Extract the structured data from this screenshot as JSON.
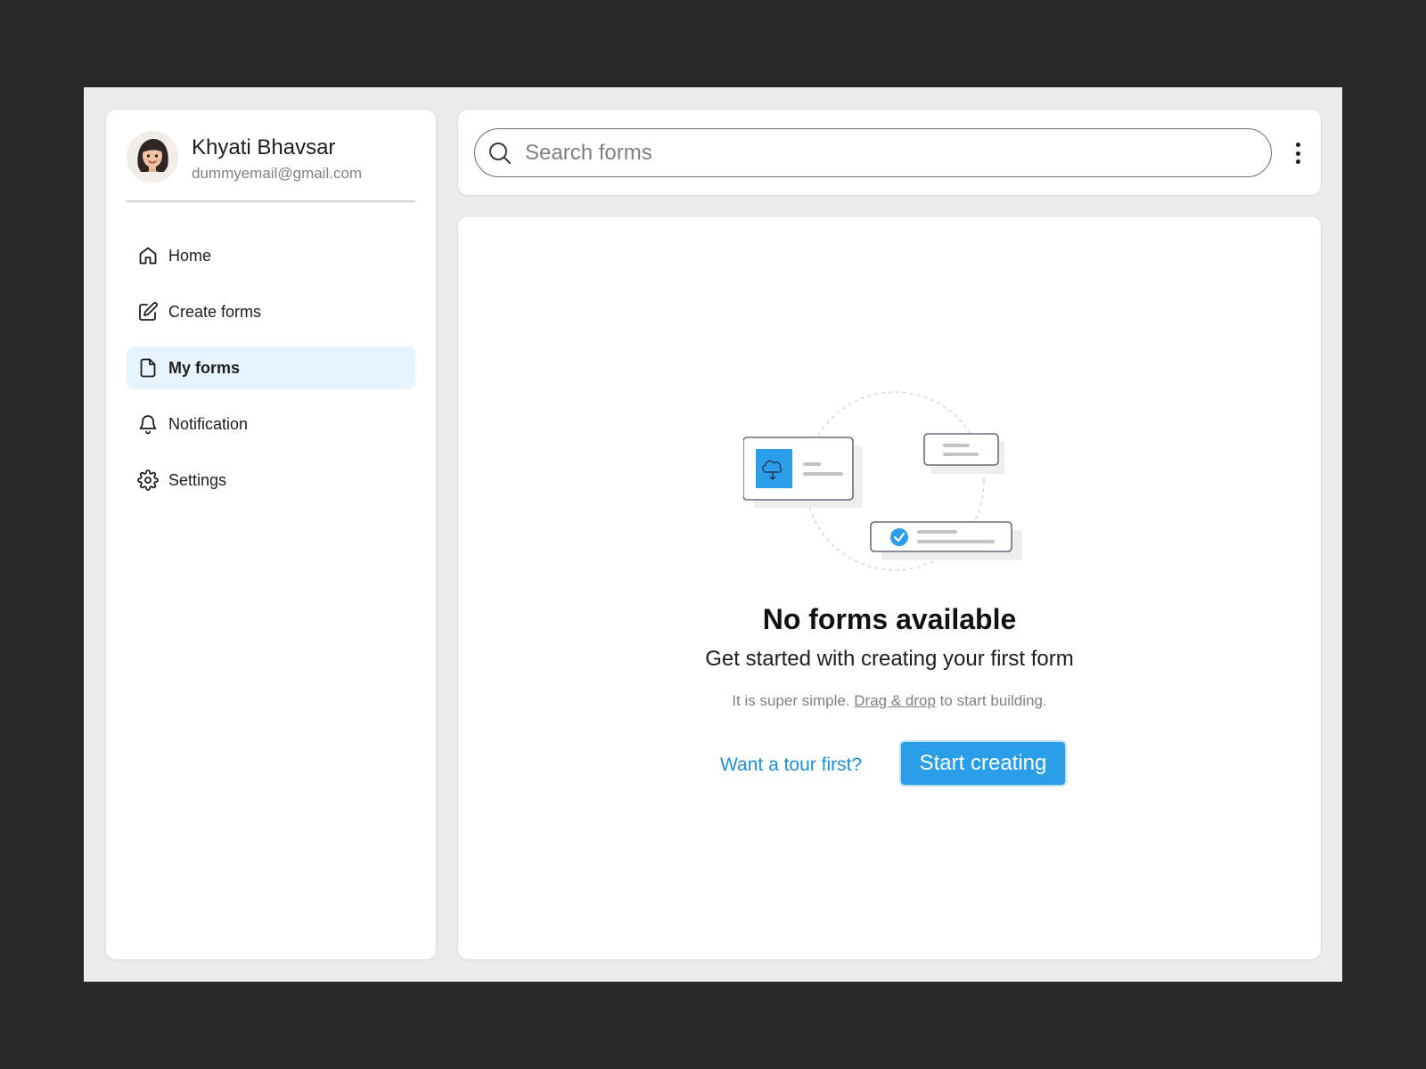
{
  "user": {
    "name": "Khyati Bhavsar",
    "email": "dummyemail@gmail.com"
  },
  "sidebar": {
    "items": [
      {
        "label": "Home",
        "icon": "home-icon",
        "active": false
      },
      {
        "label": "Create forms",
        "icon": "edit-icon",
        "active": false
      },
      {
        "label": "My forms",
        "icon": "file-icon",
        "active": true
      },
      {
        "label": "Notification",
        "icon": "bell-icon",
        "active": false
      },
      {
        "label": "Settings",
        "icon": "gear-icon",
        "active": false
      }
    ]
  },
  "search": {
    "placeholder": "Search forms",
    "value": ""
  },
  "empty_state": {
    "title": "No forms available",
    "subtitle": "Get started with creating your first form",
    "hint_prefix": "It is super simple. ",
    "hint_link": "Drag & drop",
    "hint_suffix": " to start building.",
    "tour_link": "Want a tour first?",
    "cta_label": "Start creating"
  },
  "colors": {
    "accent": "#2a9ee8",
    "active_nav_bg": "#e6f4fd",
    "link": "#1a90e0",
    "page_bg": "#282828",
    "app_bg": "#ececec"
  }
}
